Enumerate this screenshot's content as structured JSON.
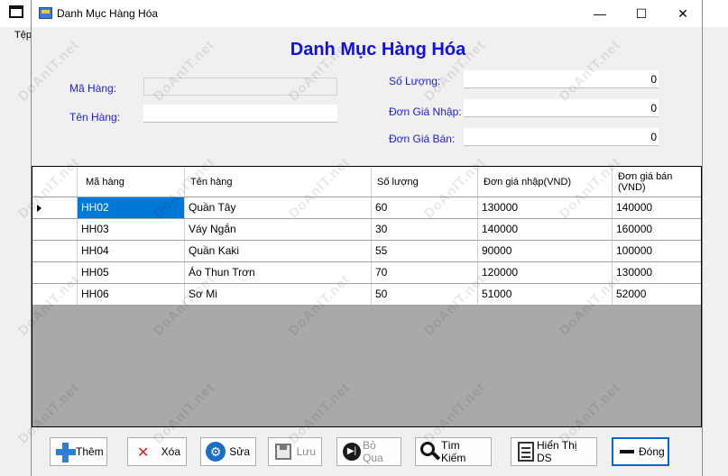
{
  "background": {
    "left_menu_text": "Tệp"
  },
  "window": {
    "title": "Danh Mục Hàng Hóa",
    "controls": {
      "minimize": "—",
      "maximize": "☐",
      "close": "✕"
    }
  },
  "form": {
    "heading": "Danh Mục Hàng Hóa",
    "fields": {
      "ma_hang": {
        "label": "Mã Hàng:",
        "value": ""
      },
      "ten_hang": {
        "label": "Tên Hàng:",
        "value": ""
      },
      "so_luong": {
        "label": "Số Lượng:",
        "value": "0"
      },
      "don_gia_nhap": {
        "label": "Đơn Giá Nhập:",
        "value": "0"
      },
      "don_gia_ban": {
        "label": "Đơn Giá Bán:",
        "value": "0"
      }
    }
  },
  "table": {
    "columns": [
      "Mã hàng",
      "Tên hàng",
      "Số lượng",
      "Đơn giá nhập(VND)",
      "Đơn giá bán (VND)"
    ],
    "rows": [
      [
        "HH02",
        "Quần Tây",
        "60",
        "130000",
        "140000"
      ],
      [
        "HH03",
        " Váy Ngắn",
        "30",
        "140000",
        "160000"
      ],
      [
        "HH04",
        "Quần Kaki",
        "55",
        "90000",
        "100000"
      ],
      [
        "HH05",
        "Áo Thun Trơn",
        "70",
        "120000",
        "130000"
      ],
      [
        "HH06",
        "Sơ Mi",
        "50",
        "51000",
        "52000"
      ]
    ]
  },
  "buttons": {
    "them": "Thêm",
    "xoa": "Xóa",
    "sua": "Sửa",
    "luu": "Lưu",
    "bo_qua": "Bỏ Qua",
    "tim_kiem": "Tìm Kiếm",
    "hien_thi_ds": "Hiển Thị DS",
    "dong": "Đóng"
  },
  "watermark": "DoAnIT.net",
  "colors": {
    "label_blue": "#1f1fd1",
    "heading_blue": "#1010e0",
    "selection": "#0078d7"
  }
}
